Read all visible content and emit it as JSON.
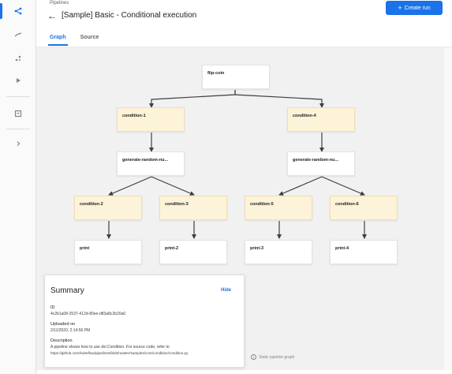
{
  "breadcrumb": "Pipelines",
  "title": "[Sample] Basic - Conditional execution",
  "create_run_label": "Create run",
  "tabs": [
    {
      "label": "Graph",
      "active": true
    },
    {
      "label": "Source",
      "active": false
    }
  ],
  "nodes": {
    "flip_coin": "flip-coin",
    "condition_1": "condition-1",
    "condition_4": "condition-4",
    "generate_left": "generate-random-nu...",
    "generate_right": "generate-random-nu...",
    "condition_2": "condition-2",
    "condition_3": "condition-3",
    "condition_5": "condition-5",
    "condition_6": "condition-6",
    "print": "print",
    "print_2": "print-2",
    "print_3": "print-3",
    "print_4": "print-4"
  },
  "summary": {
    "title": "Summary",
    "hide_label": "Hide",
    "id_label": "ID",
    "id_value": "4c2b1a08-2537-412d-80ee-d83a8c2b20a6",
    "uploaded_label": "Uploaded on",
    "uploaded_value": "2/11/2020, 2:14:56 PM",
    "description_label": "Description",
    "description_line1": "A pipeline shows how to use dsl.Condition. For source code, refer to",
    "description_line2": "https://github.com/kubeflow/pipelines/blob/master/samples/core/condition/condition.py"
  },
  "static_note": "Static pipeline graph",
  "colors": {
    "accent": "#1a73e8",
    "condition_fill": "#fcf3d9",
    "canvas_bg": "#f1f1f1"
  },
  "icons": {
    "rail": [
      "pipelines-icon",
      "experiments-icon",
      "artifacts-icon",
      "runs-icon",
      "archive-icon",
      "expand-icon"
    ],
    "back": "arrow-back-icon",
    "info": "info-icon"
  }
}
